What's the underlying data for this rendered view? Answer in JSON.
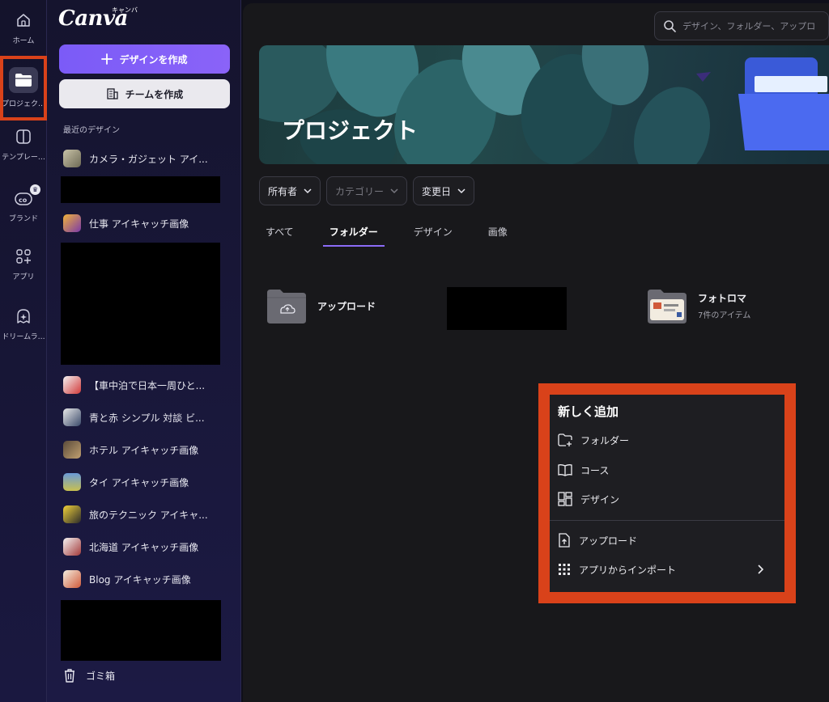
{
  "rail": {
    "items": [
      {
        "label": "ホーム",
        "icon": "home-icon"
      },
      {
        "label": "プロジェク…",
        "icon": "folder-icon"
      },
      {
        "label": "テンプレー…",
        "icon": "template-icon"
      },
      {
        "label": "ブランド",
        "icon": "brand-icon"
      },
      {
        "label": "アプリ",
        "icon": "apps-icon"
      },
      {
        "label": "ドリームラ…",
        "icon": "dream-lab-icon"
      }
    ]
  },
  "sidebar": {
    "logo": "Canva",
    "logo_sub": "キャンバ",
    "create_design": "デザインを作成",
    "create_team": "チームを作成",
    "recent_title": "最近のデザイン",
    "recent": [
      "カメラ・ガジェット アイ...",
      "仕事 アイキャッチ画像",
      "【車中泊で日本一周ひと...",
      "青と赤 シンプル 対談 ビ...",
      "ホテル アイキャッチ画像",
      "タイ アイキャッチ画像",
      "旅のテクニック アイキャ...",
      "北海道 アイキャッチ画像",
      "Blog アイキャッチ画像"
    ],
    "trash": "ゴミ箱"
  },
  "main": {
    "search_placeholder": "デザイン、フォルダー、アップロ",
    "banner_title": "プロジェクト",
    "filters": [
      "所有者",
      "カテゴリー",
      "変更日"
    ],
    "tabs": [
      "すべて",
      "フォルダー",
      "デザイン",
      "画像"
    ],
    "active_tab": "フォルダー",
    "folders": [
      {
        "name": "アップロード",
        "sub": ""
      },
      {
        "name": "フォトロマ",
        "sub": "7件のアイテム"
      }
    ]
  },
  "menu": {
    "title": "新しく追加",
    "items": [
      "フォルダー",
      "コース",
      "デザイン"
    ],
    "items2": [
      "アップロード",
      "アプリからインポート"
    ]
  },
  "colors": {
    "accent": "#8b6cf7",
    "highlight": "#d9421a",
    "background": "#18181b"
  }
}
